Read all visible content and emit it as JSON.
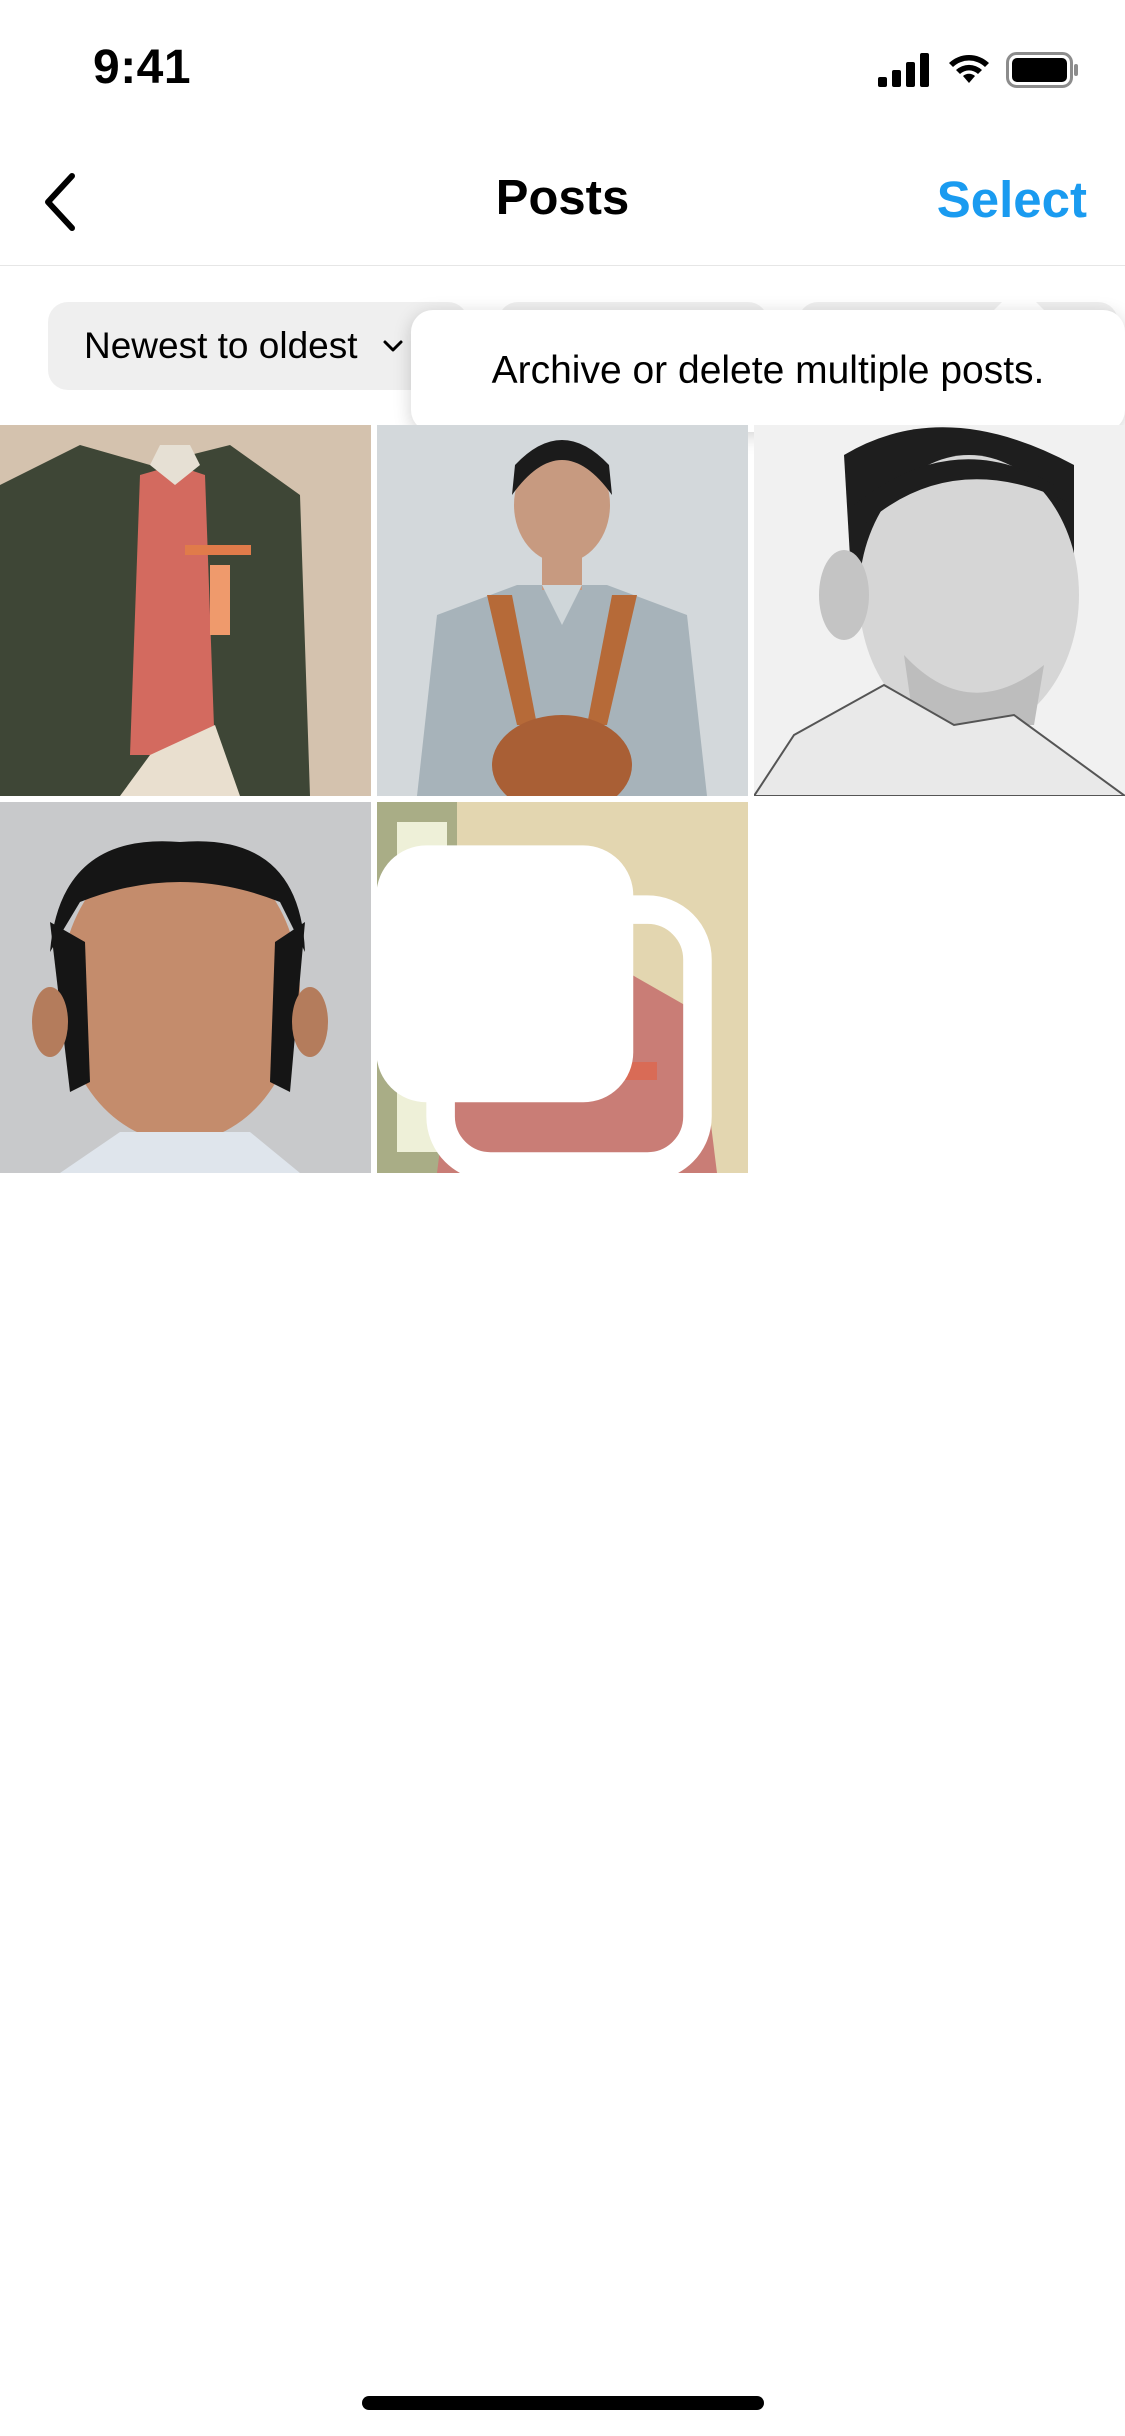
{
  "status_bar": {
    "time": "9:41",
    "icons": [
      "signal-icon",
      "wifi-icon",
      "battery-icon"
    ]
  },
  "nav": {
    "back_icon": "chevron-left-icon",
    "title": "Posts",
    "select_label": "Select"
  },
  "filters": {
    "sort_label": "Newest to oldest",
    "sort_icon": "chevron-down-icon"
  },
  "tooltip": {
    "text": "Archive or delete multiple posts."
  },
  "colors": {
    "accent": "#1a9bf0",
    "chip_bg": "#efefef",
    "divider": "#e6e6e6"
  },
  "posts": [
    {
      "kind": "photo",
      "description_icon": "portrait-green-jacket"
    },
    {
      "kind": "photo",
      "description_icon": "portrait-grey-shirt-suspenders"
    },
    {
      "kind": "photo",
      "description_icon": "portrait-pencil-sketch"
    },
    {
      "kind": "photo",
      "description_icon": "portrait-low-angle"
    },
    {
      "kind": "carousel",
      "description_icon": "portrait-pink-uniform",
      "badge_icon": "multiple-posts-icon"
    }
  ]
}
